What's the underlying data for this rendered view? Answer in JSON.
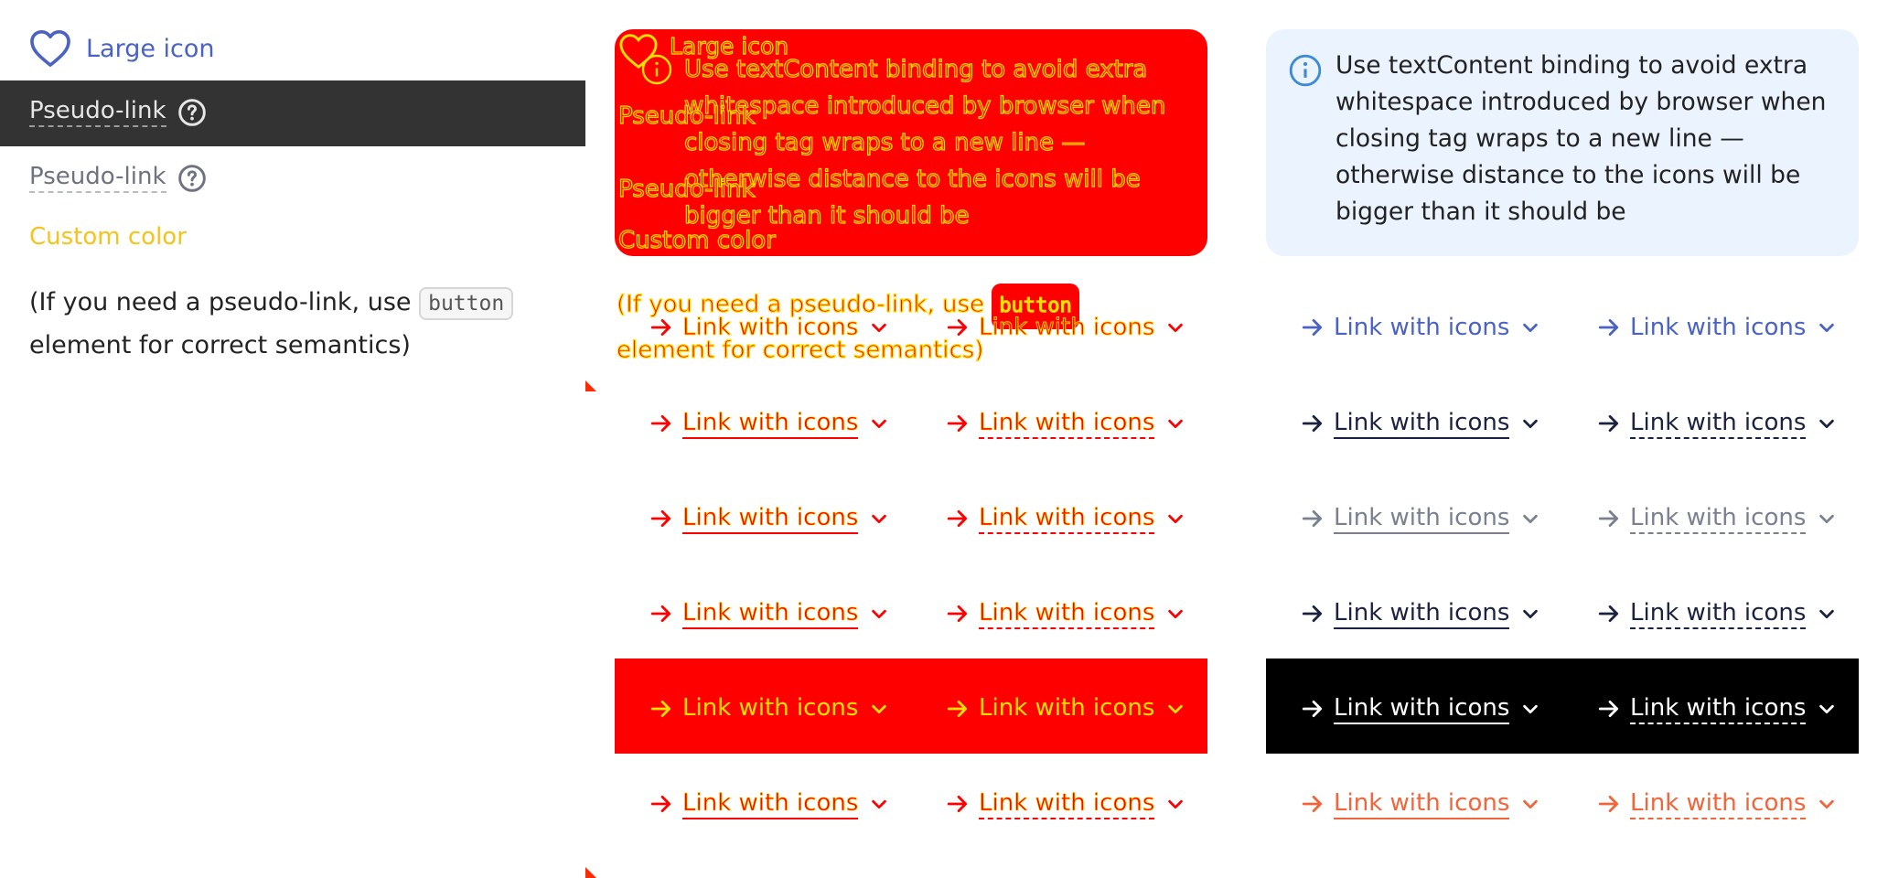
{
  "colors": {
    "accent": "#4a62c4",
    "dark_row_bg": "#333333",
    "custom_color": "#f6c31a",
    "info_bg": "#eaf3fe",
    "red": "#ff0000",
    "yellow": "#ffe000",
    "link_black": "#1b2140",
    "link_gray": "#7a8090",
    "link_orange": "#f0653a"
  },
  "left": {
    "large_icon_label": "Large icon",
    "large_icon": "heart-icon",
    "pseudo_link_dark": "Pseudo-link",
    "pseudo_link_light": "Pseudo-link",
    "help_icon": "question-circle-icon",
    "custom_color_label": "Custom color",
    "note_before": "(If you need a pseudo-link, use ",
    "note_code": "button",
    "note_after": " element for correct semantics)"
  },
  "middle": {
    "large_icon_label": "Large icon",
    "info_text": "Use textContent binding to avoid extra whitespace introduced by browser when closing tag wraps to a new line — otherwise distance to the icons will be bigger than it should be",
    "pseudo_link_a": "Pseudo-link",
    "pseudo_link_b": "Pseudo-link",
    "custom_color_label": "Custom color",
    "note_before": "(If you need a pseudo-link, use ",
    "note_code": "button",
    "note_after": "element for correct semantics)"
  },
  "right": {
    "info_icon": "info-circle-icon",
    "info_text": "Use textContent binding to avoid extra whitespace introduced by browser when closing tag wraps to a new line — otherwise distance to the icons will be bigger than it should be"
  },
  "link_label": "Link with icons",
  "link_icons": {
    "left": "arrow-right-icon",
    "right": "chevron-down-icon"
  }
}
